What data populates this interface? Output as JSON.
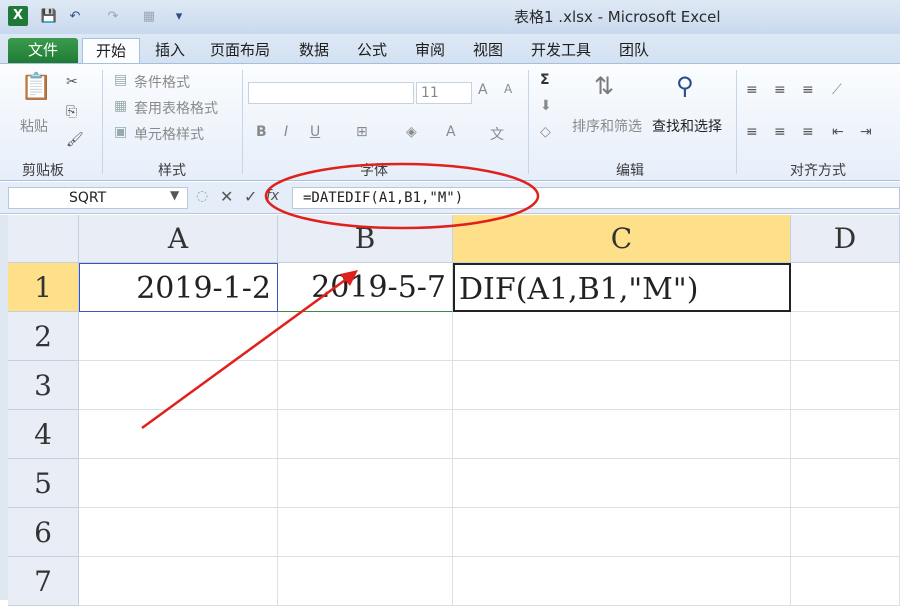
{
  "window": {
    "title": "表格1 .xlsx - Microsoft Excel",
    "app_logo": "X"
  },
  "qat": {
    "icons": [
      "save-icon",
      "undo-icon",
      "redo-icon",
      "customize-icon"
    ]
  },
  "tabs": [
    {
      "label": "文件"
    },
    {
      "label": "开始"
    },
    {
      "label": "插入"
    },
    {
      "label": "页面布局"
    },
    {
      "label": "数据"
    },
    {
      "label": "公式"
    },
    {
      "label": "审阅"
    },
    {
      "label": "视图"
    },
    {
      "label": "开发工具"
    },
    {
      "label": "团队"
    }
  ],
  "ribbon": {
    "clipboard": {
      "paste": "粘贴",
      "label": "剪贴板"
    },
    "styles": {
      "conditional": "条件格式",
      "table": "套用表格格式",
      "cell": "单元格样式",
      "label": "样式"
    },
    "font": {
      "size": "11",
      "label": "字体"
    },
    "editing": {
      "sort": "排序和筛选",
      "find": "查找和选择",
      "label": "编辑"
    },
    "alignment": {
      "label": "对齐方式"
    }
  },
  "formula_bar": {
    "name_box": "SQRT",
    "fx": "fx",
    "formula": "=DATEDIF(A1,B1,\"M\")"
  },
  "sheet": {
    "columns": [
      "A",
      "B",
      "C",
      "D"
    ],
    "rows": [
      "1",
      "2",
      "3",
      "4",
      "5",
      "6",
      "7"
    ],
    "cells": {
      "A1": "2019-1-2",
      "B1": "2019-5-7",
      "C1": "DIF(A1,B1,\"M\")"
    }
  },
  "annotation": {
    "color": "#e0201b"
  }
}
